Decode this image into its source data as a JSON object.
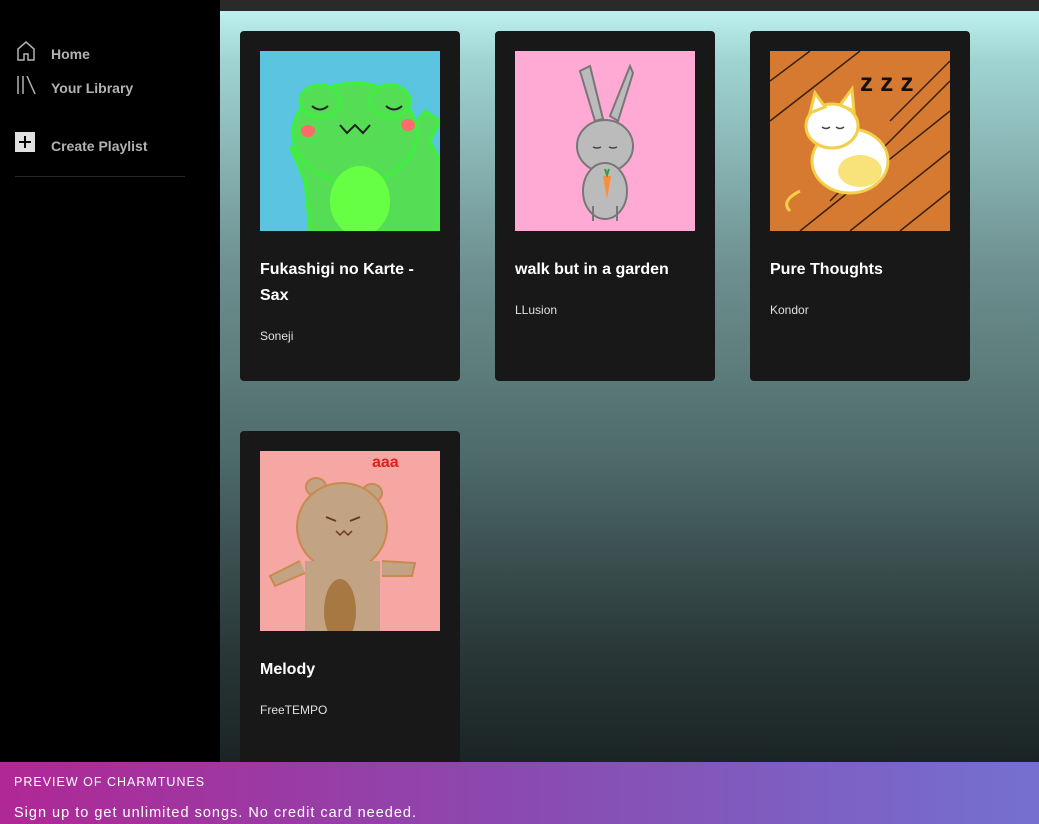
{
  "sidebar": {
    "home_label": "Home",
    "library_label": "Your Library",
    "create_playlist_label": "Create Playlist"
  },
  "cards": [
    {
      "title": "Fukashigi no Karte - Sax",
      "artist": "Soneji",
      "art": "green-frog-cover"
    },
    {
      "title": "walk but in a garden",
      "artist": "LLusion",
      "art": "gray-bunny-cover"
    },
    {
      "title": "Pure Thoughts",
      "artist": "Kondor",
      "art": "sleeping-cat-cover"
    },
    {
      "title": "Melody",
      "artist": "FreeTEMPO",
      "art": "bear-cover"
    }
  ],
  "bear_art_text": "aaa",
  "footer": {
    "preview_label": "PREVIEW OF CHARMTUNES",
    "signup_text": "Sign up to get unlimited songs. No credit card needed."
  },
  "colors": {
    "card_bg": "#181818",
    "sidebar_bg": "#000000",
    "footer_start": "#af2896",
    "footer_end": "#7470d0"
  }
}
